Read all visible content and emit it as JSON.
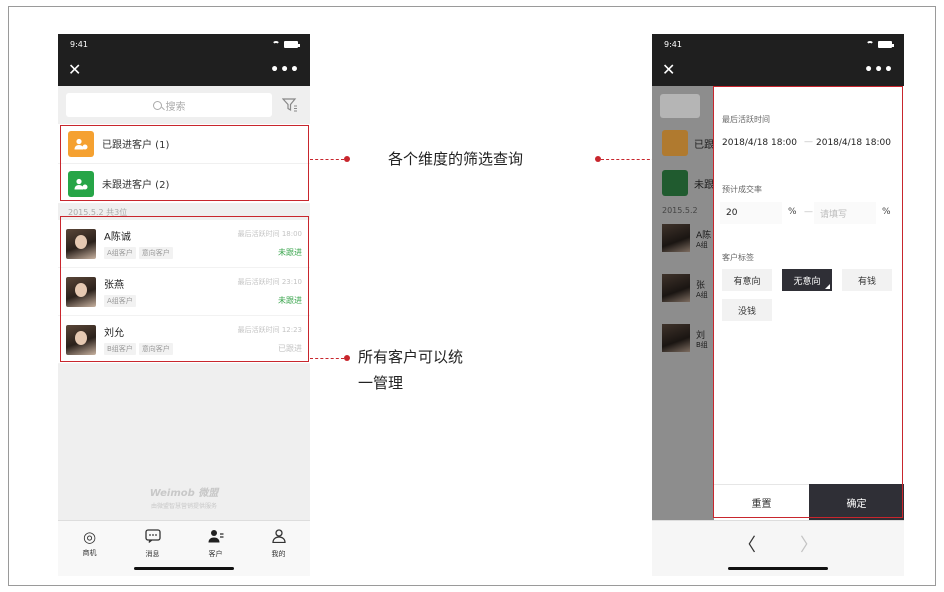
{
  "status": {
    "time": "9:41"
  },
  "left": {
    "search_placeholder": "搜索",
    "groups": [
      {
        "label": "已跟进客户 (1)",
        "color": "#f5a131"
      },
      {
        "label": "未跟进客户 (2)",
        "color": "#26a547"
      }
    ],
    "date_summary": "2015.5.2 共3位",
    "customers": [
      {
        "name": "A陈诚",
        "tags": [
          "A组客户",
          "意向客户"
        ],
        "time": "最后活跃时间 18:00",
        "status": "未跟进"
      },
      {
        "name": "张燕",
        "tags": [
          "A组客户"
        ],
        "time": "最后活跃时间 23:10",
        "status": "未跟进"
      },
      {
        "name": "刘允",
        "tags": [
          "B组客户",
          "意向客户"
        ],
        "time": "最后活跃时间 12:23",
        "status": "已跟进"
      }
    ],
    "brand": {
      "name": "Weimob 微盟",
      "sub": "由微盟智慧营销提供服务"
    },
    "tabs": [
      "商机",
      "消息",
      "客户",
      "我的"
    ]
  },
  "annotations": {
    "filter": "各个维度的筛选查询",
    "manage_line1": "所有客户可以统",
    "manage_line2": "一管理"
  },
  "right": {
    "dim_rows": [
      "已跟",
      "未跟"
    ],
    "dim_date": "2015.5.2",
    "dim_names": [
      "A陈",
      "张",
      "刘"
    ],
    "dim_sub": [
      "A组",
      "A组",
      "B组"
    ],
    "filter_panel": {
      "last_active_label": "最后活跃时间",
      "date_from": "2018/4/18 18:00",
      "date_to": "2018/4/18 18:00",
      "range_sep": "—",
      "rate_label": "预计成交率",
      "rate_from": "20",
      "rate_to_placeholder": "请填写",
      "pct": "%",
      "tags_label": "客户标签",
      "tags": [
        "有意向",
        "无意向",
        "有钱",
        "没钱"
      ],
      "active_tag": "无意向",
      "reset": "重置",
      "confirm": "确定"
    },
    "back": "〈",
    "forward": "〉"
  }
}
